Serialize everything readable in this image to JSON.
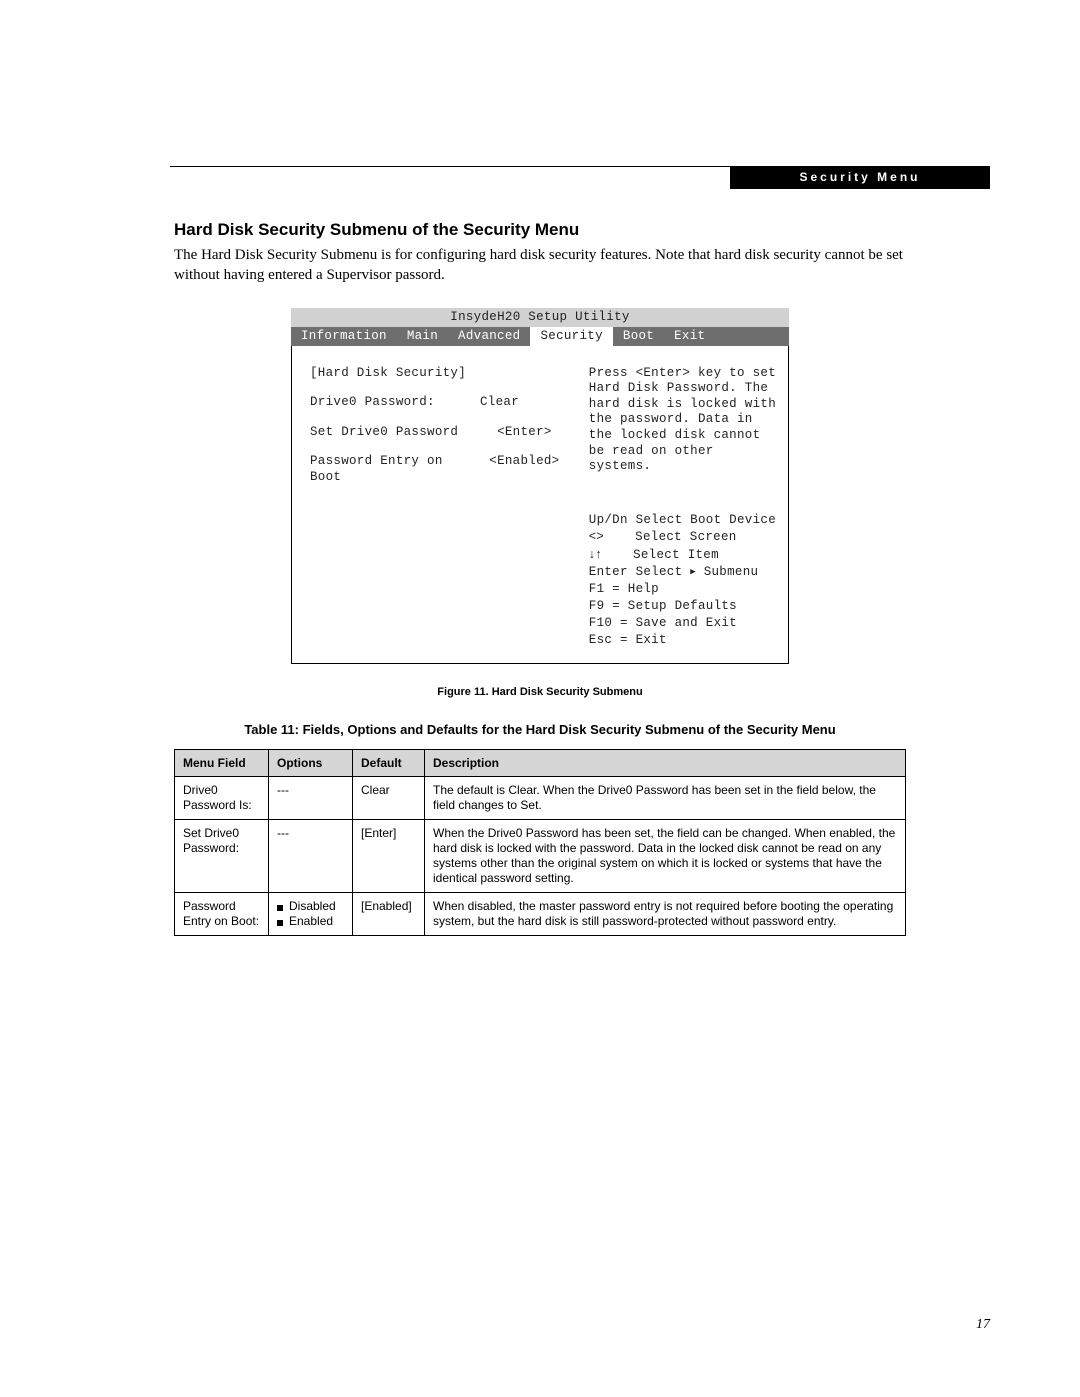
{
  "header": {
    "breadcrumb": "Security Menu"
  },
  "section": {
    "title": "Hard Disk Security Submenu of the Security Menu",
    "intro": "The Hard Disk Security Submenu is for configuring hard disk security features. Note that hard disk security cannot be set without having entered a Supervisor passord."
  },
  "bios": {
    "utility_title": "InsydeH20 Setup Utility",
    "tabs": [
      "Information",
      "Main",
      "Advanced",
      "Security",
      "Boot",
      "Exit"
    ],
    "active_tab": "Security",
    "left": {
      "heading": "[Hard Disk Security]",
      "rows": [
        {
          "label": "Drive0 Password:",
          "value": "Clear",
          "align": "left"
        },
        {
          "label": "Set Drive0 Password",
          "value": "<Enter>",
          "align": "right"
        },
        {
          "label": "Password Entry on Boot",
          "value": "<Enabled>",
          "align": "right"
        }
      ]
    },
    "right": {
      "help_text": "Press <Enter> key to set Hard Disk Password. The hard disk is locked with the password. Data in the locked disk cannot be read on other systems.",
      "nav": [
        "Up/Dn Select Boot Device",
        "<>    Select Screen",
        "↓↑    Select Item",
        "Enter Select ▸ Submenu",
        "F1  = Help",
        "F9  = Setup Defaults",
        "F10 = Save and Exit",
        "Esc = Exit"
      ]
    }
  },
  "figure_caption": "Figure 11.  Hard Disk Security Submenu",
  "table": {
    "title": "Table 11: Fields, Options and Defaults for the Hard Disk Security Submenu of the Security Menu",
    "headers": [
      "Menu Field",
      "Options",
      "Default",
      "Description"
    ],
    "rows": [
      {
        "field": "Drive0 Password Is:",
        "options": [
          "---"
        ],
        "default": "Clear",
        "description": "The default is Clear. When the Drive0 Password has been set in the field below, the field changes to Set."
      },
      {
        "field": "Set Drive0 Password:",
        "options": [
          "---"
        ],
        "default": "[Enter]",
        "description": "When the Drive0 Password has been set, the field can be changed. When enabled, the hard disk is locked with the password. Data in the locked disk cannot be read on any systems other than the original system on which it is locked or systems that have the identical password setting."
      },
      {
        "field": "Password Entry on Boot:",
        "options": [
          "Disabled",
          "Enabled"
        ],
        "default": "[Enabled]",
        "description": "When disabled, the master password entry is not required before booting the operating system, but the hard disk is still password-protected without password entry."
      }
    ]
  },
  "page_number": "17"
}
